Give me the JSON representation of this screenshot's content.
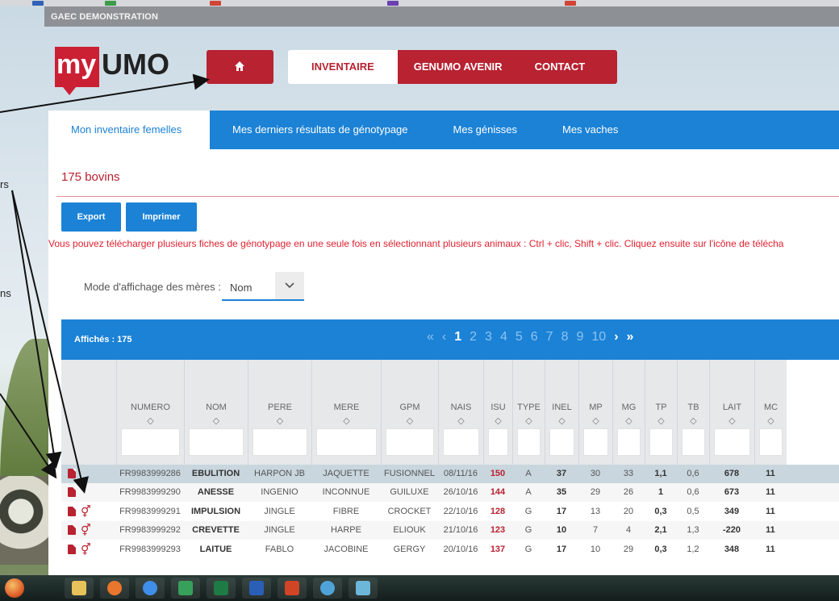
{
  "farm": {
    "name": "GAEC DEMONSTRATION"
  },
  "logo": {
    "my": "my",
    "umo": "UMO"
  },
  "nav": {
    "items": [
      "INVENTAIRE",
      "GENUMO AVENIR",
      "CONTACT"
    ]
  },
  "tabs": [
    "Mon inventaire femelles",
    "Mes derniers résultats de génotypage",
    "Mes génisses",
    "Mes vaches"
  ],
  "panel": {
    "count": "175 bovins",
    "export": "Export",
    "print": "Imprimer",
    "info": "Vous pouvez télécharger plusieurs fiches de génotypage en une seule fois en sélectionnant plusieurs animaux : Ctrl + clic, Shift + clic. Cliquez ensuite sur l'icône de télécha",
    "mode_label": "Mode d'affichage des mères :",
    "mode_value": "Nom"
  },
  "table": {
    "shown": "Affichés : 175",
    "pager": {
      "first": "«",
      "prev": "‹",
      "pages": [
        "1",
        "2",
        "3",
        "4",
        "5",
        "6",
        "7",
        "8",
        "9",
        "10"
      ],
      "current": "1",
      "next": "›",
      "last": "»"
    },
    "sort_icon": "◇",
    "columns": [
      "NUMERO",
      "NOM",
      "PERE",
      "MERE",
      "GPM",
      "NAIS",
      "ISU",
      "TYPE",
      "INEL",
      "MP",
      "MG",
      "TP",
      "TB",
      "LAIT",
      "MC"
    ],
    "rows": [
      {
        "numero": "FR9983999286",
        "nom": "EBULITION",
        "pere": "HARPON JB",
        "mere": "JAQUETTE",
        "gpm": "FUSIONNEL",
        "nais": "08/11/16",
        "isu": "150",
        "type": "A",
        "inel": "37",
        "mp": "30",
        "mg": "33",
        "tp": "1,1",
        "tb": "0,6",
        "lait": "678",
        "mc": "11",
        "gene": false
      },
      {
        "numero": "FR9983999290",
        "nom": "ANESSE",
        "pere": "INGENIO",
        "mere": "INCONNUE",
        "gpm": "GUILUXE",
        "nais": "26/10/16",
        "isu": "144",
        "type": "A",
        "inel": "35",
        "mp": "29",
        "mg": "26",
        "tp": "1",
        "tb": "0,6",
        "lait": "673",
        "mc": "11",
        "gene": false
      },
      {
        "numero": "FR9983999291",
        "nom": "IMPULSION",
        "pere": "JINGLE",
        "mere": "FIBRE",
        "gpm": "CROCKET",
        "nais": "22/10/16",
        "isu": "128",
        "type": "G",
        "inel": "17",
        "mp": "13",
        "mg": "20",
        "tp": "0,3",
        "tb": "0,5",
        "lait": "349",
        "mc": "11",
        "gene": true
      },
      {
        "numero": "FR9983999292",
        "nom": "CREVETTE",
        "pere": "JINGLE",
        "mere": "HARPE",
        "gpm": "ELIOUK",
        "nais": "21/10/16",
        "isu": "123",
        "type": "G",
        "inel": "10",
        "mp": "7",
        "mg": "4",
        "tp": "2,1",
        "tb": "1,3",
        "lait": "-220",
        "mc": "11",
        "gene": true
      },
      {
        "numero": "FR9983999293",
        "nom": "LAITUE",
        "pere": "FABLO",
        "mere": "JACOBINE",
        "gpm": "GERGY",
        "nais": "20/10/16",
        "isu": "137",
        "type": "G",
        "inel": "17",
        "mp": "10",
        "mg": "29",
        "tp": "0,3",
        "tb": "1,2",
        "lait": "348",
        "mc": "11",
        "gene": true
      }
    ]
  },
  "side_text": {
    "rs": "rs",
    "ns": "ns"
  },
  "colors": {
    "brand_red": "#b82231",
    "brand_blue": "#1b82d6",
    "alert_red": "#e0212f"
  },
  "icons": {
    "home": "home-icon",
    "caret": "chevron-down-icon",
    "pdf": "pdf-icon",
    "gene": "genotype-icon"
  }
}
